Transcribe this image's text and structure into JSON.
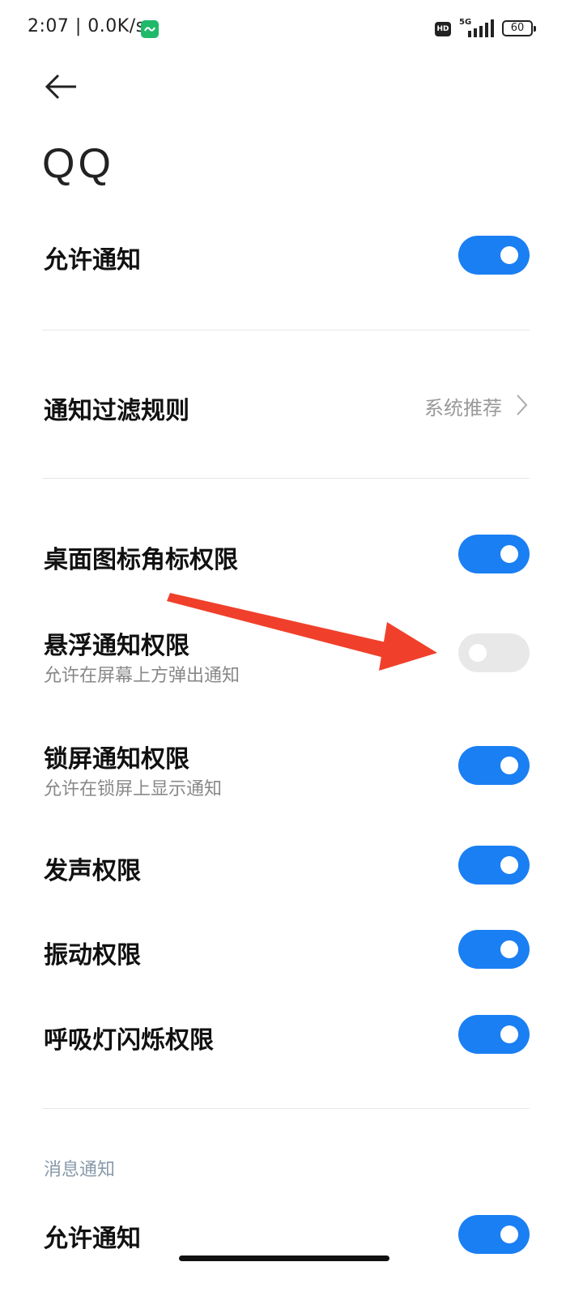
{
  "status_bar": {
    "time": "2:07 | 0.0K/s",
    "app_badge_icon": "accessibility-app-icon",
    "hd_label": "HD",
    "network_label": "5G",
    "battery": "60"
  },
  "header": {
    "back_icon": "arrow-left-icon",
    "title": "QQ"
  },
  "rows": {
    "allow_notifications": {
      "label": "允许通知",
      "enabled": true
    },
    "filter_rules": {
      "label": "通知过滤规则",
      "value": "系统推荐"
    },
    "badge_permission": {
      "label": "桌面图标角标权限",
      "enabled": true
    },
    "floating_permission": {
      "label": "悬浮通知权限",
      "sub": "允许在屏幕上方弹出通知",
      "enabled": false
    },
    "lockscreen_permission": {
      "label": "锁屏通知权限",
      "sub": "允许在锁屏上显示通知",
      "enabled": true
    },
    "sound_permission": {
      "label": "发声权限",
      "enabled": true
    },
    "vibrate_permission": {
      "label": "振动权限",
      "enabled": true
    },
    "led_permission": {
      "label": "呼吸灯闪烁权限",
      "enabled": true
    }
  },
  "section": {
    "header": "消息通知",
    "allow_notifications": {
      "label": "允许通知",
      "enabled": true
    }
  },
  "colors": {
    "toggle_on": "#1a7ff3",
    "toggle_off": "#e8e8e8",
    "annotation_arrow": "#f0402b"
  }
}
